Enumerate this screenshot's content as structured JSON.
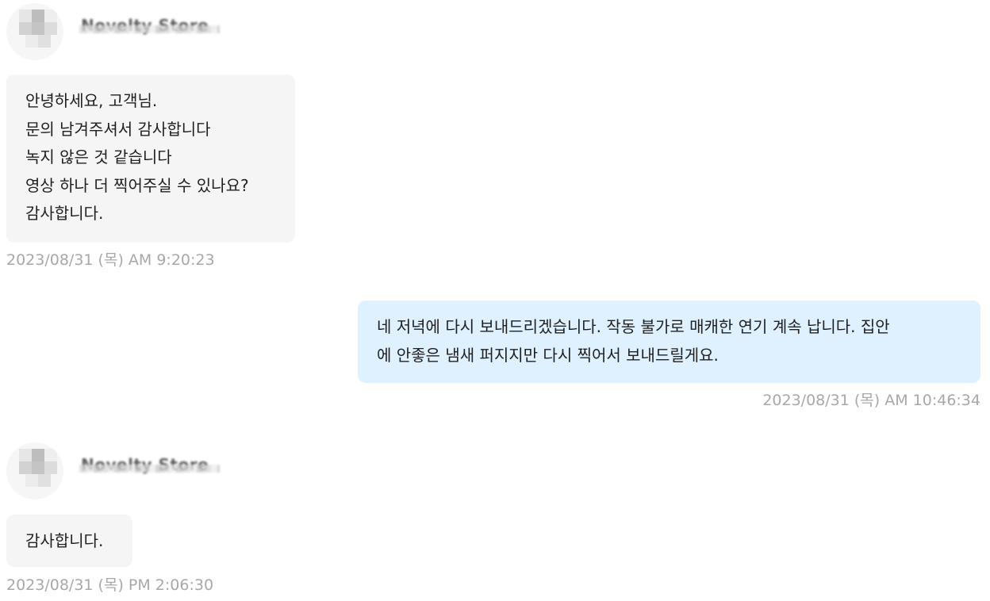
{
  "messages": [
    {
      "sender": "Novelty Store",
      "direction": "incoming",
      "lines": [
        "안녕하세요, 고객님.",
        "문의 남겨주셔서 감사합니다",
        "녹지 않은 것 같습니다",
        "영상 하나 더 찍어주실 수 있나요?",
        "감사합니다."
      ],
      "timestamp": "2023/08/31 (목) AM 9:20:23"
    },
    {
      "direction": "outgoing",
      "lines": [
        "네 저녁에 다시 보내드리겠습니다. 작동 불가로 매캐한 연기 계속 납니다. 집안",
        "에 안좋은 냄새 퍼지지만 다시 찍어서 보내드릴게요."
      ],
      "timestamp": "2023/08/31 (목) AM 10:46:34"
    },
    {
      "sender": "Novelty Store",
      "direction": "incoming",
      "lines": [
        "감사합니다."
      ],
      "timestamp": "2023/08/31 (목) PM 2:06:30"
    }
  ],
  "colors": {
    "incoming_bubble": "#f5f5f5",
    "outgoing_bubble": "#dff0ff",
    "timestamp_text": "#a8a8a8"
  }
}
